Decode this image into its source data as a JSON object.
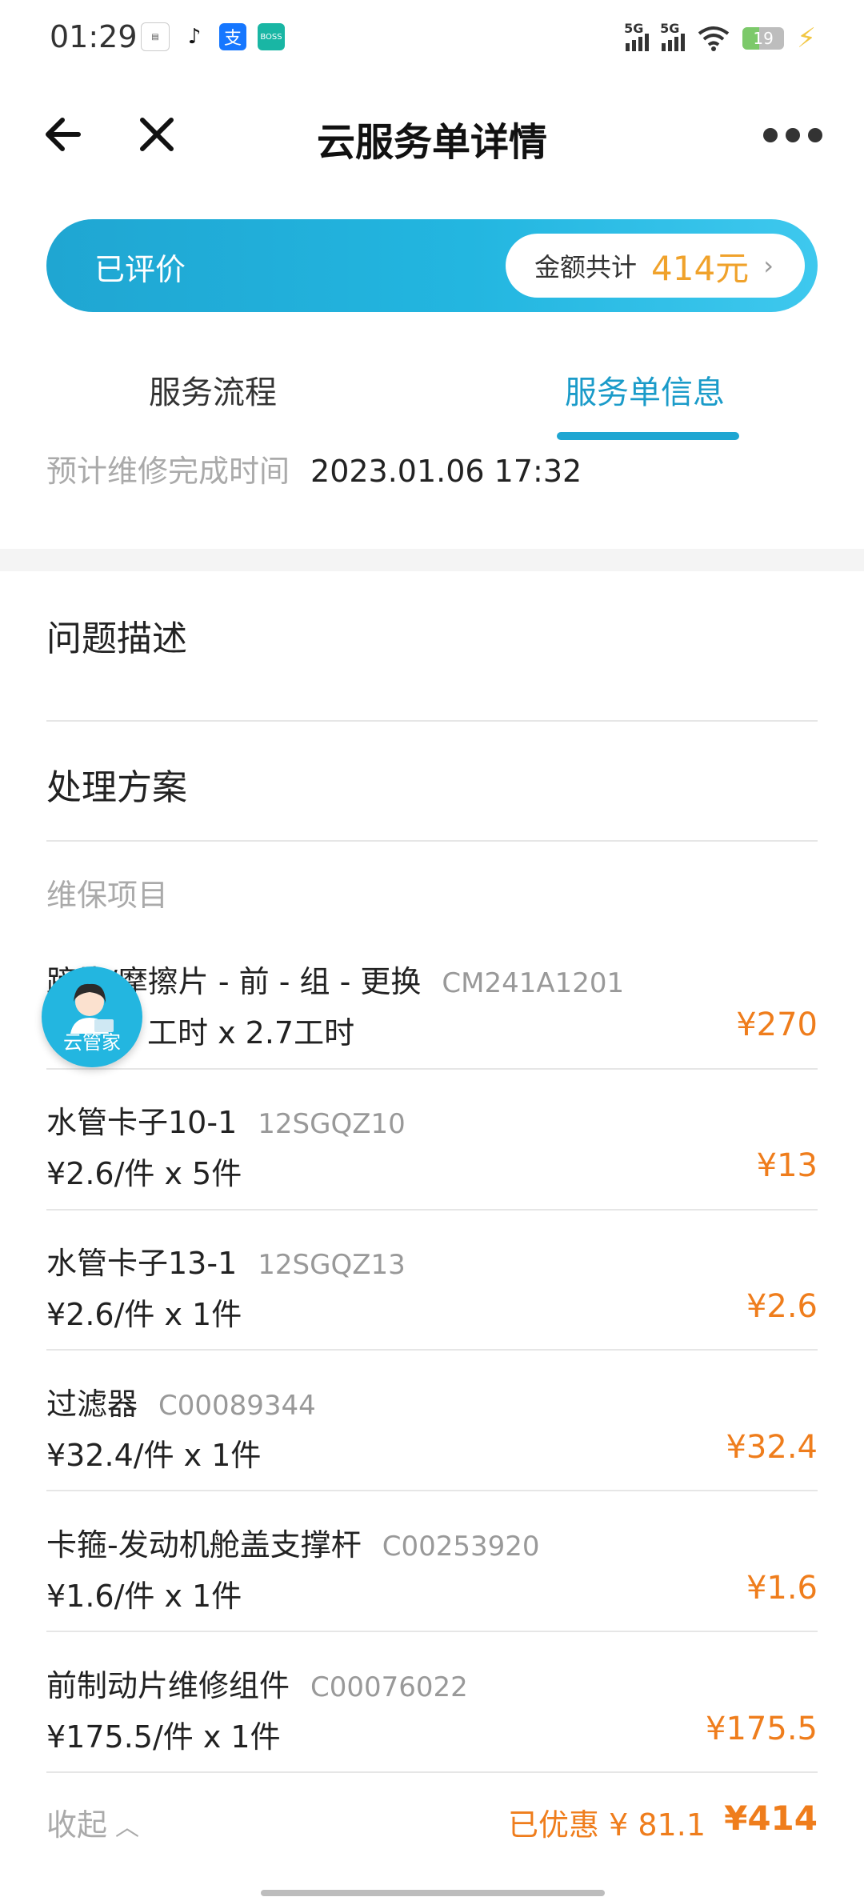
{
  "status_bar": {
    "time": "01:29",
    "network1": "5G",
    "network2": "5G",
    "battery": "19"
  },
  "nav": {
    "title": "云服务单详情"
  },
  "banner": {
    "status": "已评价",
    "amount_label": "金额共计",
    "amount_value": "414元"
  },
  "tabs": [
    {
      "label": "服务流程"
    },
    {
      "label": "服务单信息"
    }
  ],
  "estimated": {
    "label": "预计维修完成时间",
    "value": "2023.01.06 17:32"
  },
  "sections": {
    "problem": "问题描述",
    "solution": "处理方案",
    "items_title": "维保项目"
  },
  "items": [
    {
      "name": "蹄片/摩擦片 - 前 - 组 - 更换",
      "code": "CM241A1201",
      "qty": "工时  x  2.7工时",
      "total": "¥270"
    },
    {
      "name": "水管卡子10-1",
      "code": "12SGQZ10",
      "qty": "¥2.6/件  x  5件",
      "total": "¥13"
    },
    {
      "name": "水管卡子13-1",
      "code": "12SGQZ13",
      "qty": "¥2.6/件  x  1件",
      "total": "¥2.6"
    },
    {
      "name": "过滤器",
      "code": "C00089344",
      "qty": "¥32.4/件  x  1件",
      "total": "¥32.4"
    },
    {
      "name": "卡箍-发动机舱盖支撑杆",
      "code": "C00253920",
      "qty": "¥1.6/件  x  1件",
      "total": "¥1.6"
    },
    {
      "name": "前制动片维修组件",
      "code": "C00076022",
      "qty": "¥175.5/件  x  1件",
      "total": "¥175.5"
    }
  ],
  "footer": {
    "collapse_label": "收起",
    "discount": "已优惠 ¥ 81.1",
    "grand_total": "¥414"
  },
  "fab": {
    "label": "云管家"
  },
  "colors": {
    "accent": "#1fa6d2",
    "price": "#ef7d1c",
    "amount": "#f0a22b"
  }
}
